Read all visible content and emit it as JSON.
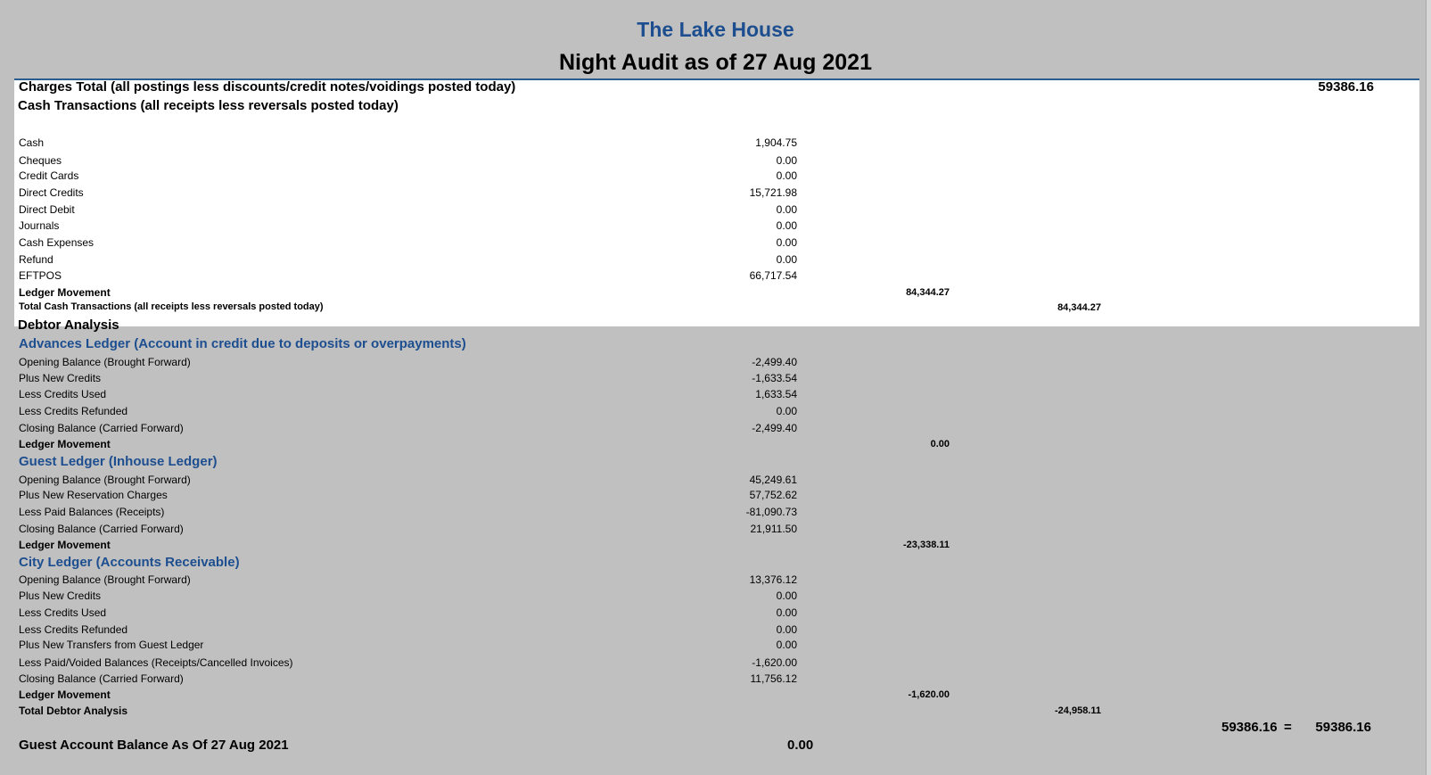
{
  "report": {
    "hotel_name": "The Lake House",
    "title": "Night Audit as of 27 Aug 2021"
  },
  "charges": {
    "label": "Charges Total (all postings less discounts/credit notes/voidings posted today)",
    "value": "59386.16"
  },
  "cash": {
    "header": "Cash Transactions (all receipts less reversals posted today)",
    "rows": [
      {
        "label": "Cash",
        "value": "1,904.75"
      },
      {
        "label": "Cheques",
        "value": "0.00"
      },
      {
        "label": "Credit Cards",
        "value": "0.00"
      },
      {
        "label": "Direct Credits",
        "value": "15,721.98"
      },
      {
        "label": "Direct Debit",
        "value": "0.00"
      },
      {
        "label": "Journals",
        "value": "0.00"
      },
      {
        "label": "Cash Expenses",
        "value": "0.00"
      },
      {
        "label": "Refund",
        "value": "0.00"
      },
      {
        "label": "EFTPOS",
        "value": "66,717.54"
      }
    ],
    "ledger_movement_label": "Ledger Movement",
    "ledger_movement_value": "84,344.27",
    "total_label": "Total Cash Transactions (all receipts less reversals posted today)",
    "total_value": "84,344.27"
  },
  "debtor": {
    "header": "Debtor Analysis",
    "advances": {
      "title": "Advances Ledger (Account in credit due to deposits or overpayments)",
      "rows": [
        {
          "label": "Opening Balance (Brought Forward)",
          "value": "-2,499.40"
        },
        {
          "label": "Plus New Credits",
          "value": "-1,633.54"
        },
        {
          "label": "Less Credits Used",
          "value": "1,633.54"
        },
        {
          "label": "Less Credits Refunded",
          "value": "0.00"
        },
        {
          "label": "Closing Balance (Carried Forward)",
          "value": "-2,499.40"
        }
      ],
      "ledger_movement_label": "Ledger Movement",
      "ledger_movement_value": "0.00"
    },
    "guest": {
      "title": "Guest Ledger (Inhouse Ledger)",
      "rows": [
        {
          "label": "Opening Balance (Brought Forward)",
          "value": "45,249.61"
        },
        {
          "label": "Plus New Reservation Charges",
          "value": "57,752.62"
        },
        {
          "label": "Less Paid Balances (Receipts)",
          "value": "-81,090.73"
        },
        {
          "label": "Closing Balance (Carried Forward)",
          "value": "21,911.50"
        }
      ],
      "ledger_movement_label": "Ledger Movement",
      "ledger_movement_value": "-23,338.11"
    },
    "city": {
      "title": "City Ledger (Accounts Receivable)",
      "rows": [
        {
          "label": "Opening Balance (Brought Forward)",
          "value": "13,376.12"
        },
        {
          "label": "Plus New Credits",
          "value": "0.00"
        },
        {
          "label": "Less Credits Used",
          "value": "0.00"
        },
        {
          "label": "Less Credits Refunded",
          "value": "0.00"
        },
        {
          "label": "Plus New Transfers from Guest Ledger",
          "value": "0.00"
        },
        {
          "label": "Less Paid/Voided Balances (Receipts/Cancelled Invoices)",
          "value": "-1,620.00"
        },
        {
          "label": "Closing Balance (Carried Forward)",
          "value": "11,756.12"
        }
      ],
      "ledger_movement_label": "Ledger Movement",
      "ledger_movement_value": "-1,620.00"
    },
    "total_label": "Total Debtor Analysis",
    "total_value": "-24,958.11"
  },
  "reconciliation": {
    "left": "59386.16",
    "equals": "=",
    "right": "59386.16"
  },
  "guest_account": {
    "label": "Guest Account Balance As Of 27 Aug 2021",
    "value": "0.00"
  }
}
